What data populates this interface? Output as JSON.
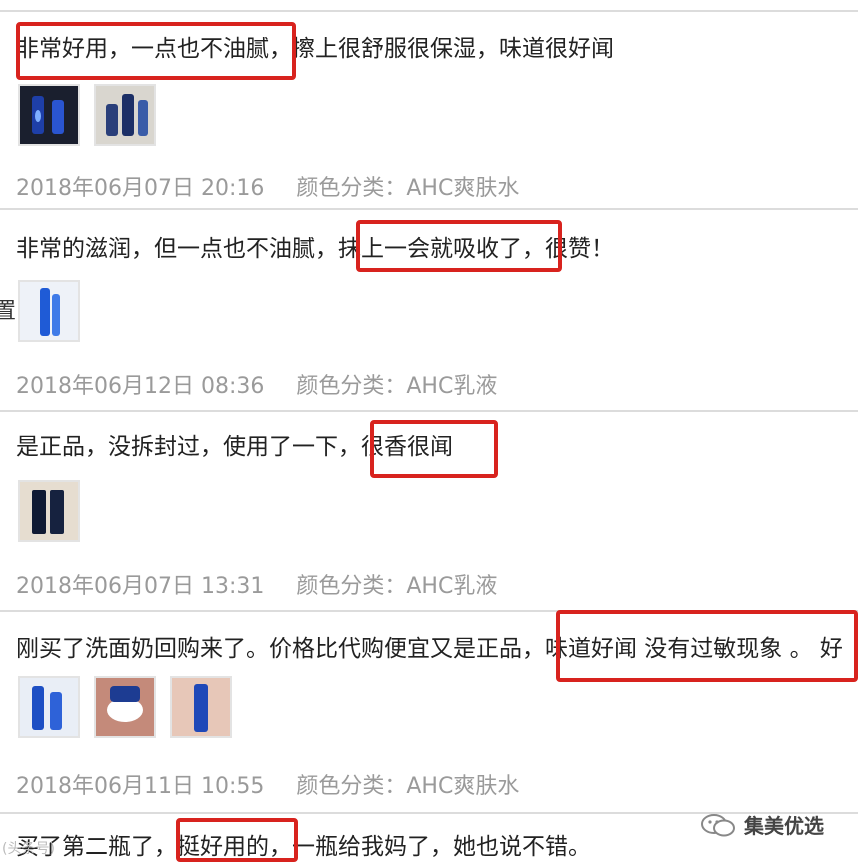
{
  "reviews": [
    {
      "text": "非常好用，一点也不油腻，擦上很舒服很保湿，味道很好闻",
      "date": "2018年06月07日 20:16",
      "variant": "颜色分类：AHC爽肤水",
      "photo_count": 2
    },
    {
      "text": "非常的滋润，但一点也不油腻，抹上一会就吸收了，很赞！",
      "date": "2018年06月12日 08:36",
      "variant": "颜色分类：AHC乳液",
      "photo_count": 1
    },
    {
      "text": "是正品，没拆封过，使用了一下，很香很闻",
      "date": "2018年06月07日 13:31",
      "variant": "颜色分类：AHC乳液",
      "photo_count": 1
    },
    {
      "text": "刚买了洗面奶回购来了。价格比代购便宜又是正品，味道好闻 没有过敏现象 。 好",
      "date": "2018年06月11日 10:55",
      "variant": "颜色分类：AHC爽肤水",
      "photo_count": 3
    },
    {
      "text": "买了第二瓶了，挺好用的，一瓶给我妈了，她也说不错。"
    }
  ],
  "side_glyph": "置",
  "watermark_left": "(头条号)",
  "watermark_right": "集美优选",
  "highlight_color": "#d8231e"
}
